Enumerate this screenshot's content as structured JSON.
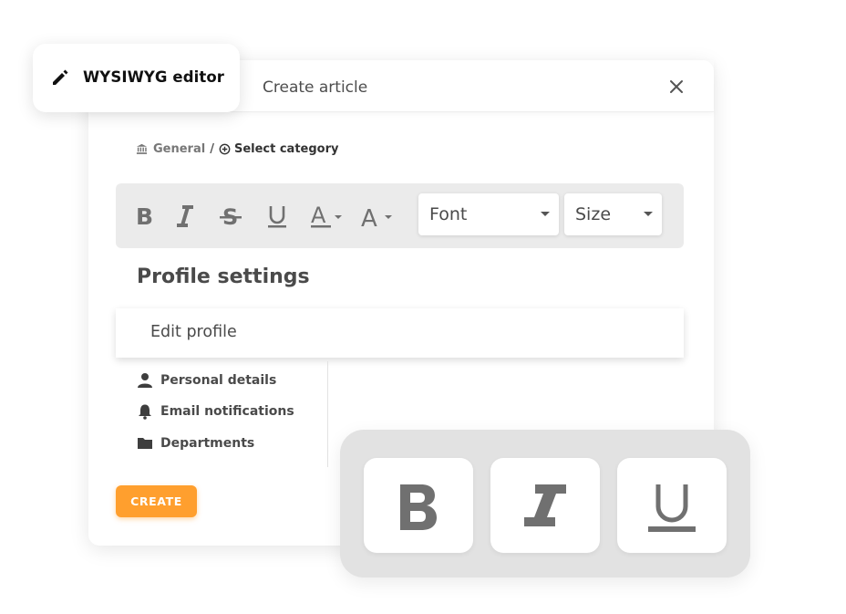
{
  "tag": {
    "icon": "pencil-icon",
    "label": "WYSIWYG editor"
  },
  "dialog": {
    "title": "Create article",
    "close_icon": "close-icon",
    "breadcrumb": {
      "root": "General",
      "separator": "/",
      "select": "Select category"
    }
  },
  "toolbar": {
    "buttons": [
      "bold-icon",
      "italic-icon",
      "strikethrough-icon",
      "underline-icon",
      "text-color-icon",
      "font-size-icon"
    ],
    "font_select": "Font",
    "size_select": "Size"
  },
  "content": {
    "heading": "Profile settings",
    "section": "Edit profile",
    "menu": [
      {
        "icon": "person-icon",
        "label": "Personal details"
      },
      {
        "icon": "bell-icon",
        "label": "Email notifications"
      },
      {
        "icon": "folder-icon",
        "label": "Departments"
      }
    ],
    "create_button": "CREATE"
  },
  "format_panel": {
    "buttons": [
      "bold-icon",
      "italic-icon",
      "underline-icon"
    ]
  },
  "colors": {
    "accent": "#ff9f2e",
    "icon_gray": "#707070",
    "toolbar_bg": "#ebebeb"
  }
}
